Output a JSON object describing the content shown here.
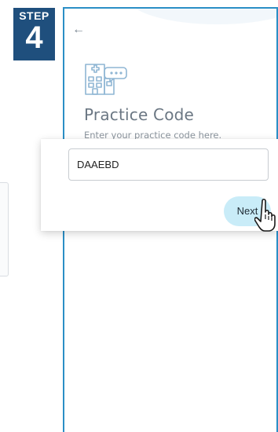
{
  "step": {
    "label": "STEP",
    "number": "4"
  },
  "navigation": {
    "back_icon": "arrow-left-icon",
    "back_glyph": "←"
  },
  "header": {
    "icon": "clinic-building-icon",
    "title": "Practice Code",
    "subtitle": "Enter your practice code here."
  },
  "form": {
    "practice_code_value": "DAAEBD",
    "next_label": "Next"
  },
  "colors": {
    "badge_bg": "#1f4f7d",
    "frame_border": "#2b8fc6",
    "next_button_bg": "#c9ecf8",
    "icon_stroke": "#8fb6d4"
  },
  "cursor": "hand-pointer-icon"
}
